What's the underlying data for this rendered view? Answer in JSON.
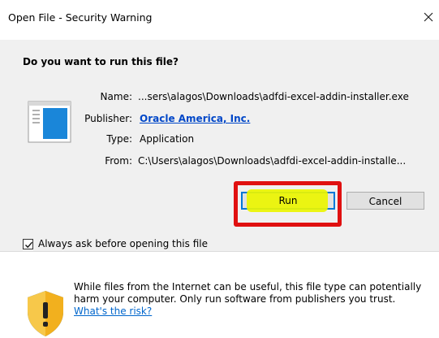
{
  "window": {
    "title": "Open File - Security Warning",
    "close_glyph": "×"
  },
  "dialog": {
    "question": "Do you want to run this file?",
    "fields": [
      {
        "label": "Name:",
        "value": "...sers\\alagos\\Downloads\\adfdi-excel-addin-installer.exe"
      },
      {
        "label": "Publisher:",
        "value": "Oracle America, Inc."
      },
      {
        "label": "Type:",
        "value": "Application"
      },
      {
        "label": "From:",
        "value": "C:\\Users\\alagos\\Downloads\\adfdi-excel-addin-installe..."
      }
    ],
    "run_label": "Run",
    "cancel_label": "Cancel",
    "always_ask_label": "Always ask before opening this file",
    "always_ask_checked": true
  },
  "footer": {
    "warning_text": "While files from the Internet can be useful, this file type can potentially harm your computer. Only run software from publishers you trust.",
    "risk_link": "What's the risk?"
  },
  "colors": {
    "highlight": "#ecf500",
    "annotation_box": "#e01010",
    "link": "#0047c8"
  },
  "icons": [
    "close-icon",
    "application-file-icon",
    "checkmark-icon",
    "security-shield-icon"
  ]
}
